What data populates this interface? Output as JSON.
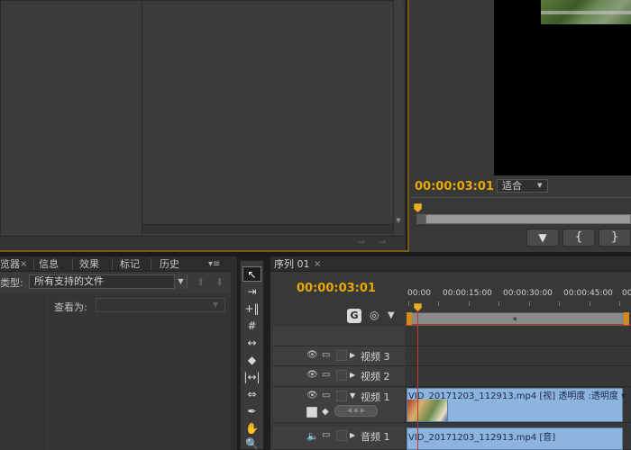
{
  "program_monitor": {
    "timecode": "00:00:03:01",
    "fit_select": "适合",
    "buttons": {
      "marker": "▼",
      "mark_in": "{",
      "mark_out": "}"
    }
  },
  "media_browser": {
    "tabs": [
      {
        "label": "览器"
      },
      {
        "label": "信息"
      },
      {
        "label": "效果"
      },
      {
        "label": "标记"
      },
      {
        "label": "历史"
      }
    ],
    "tab_close": "×",
    "menu_glyph": "▾≡",
    "type_label": "类型:",
    "type_value": "所有支持的文件",
    "view_as_label": "查看为:"
  },
  "tools": {
    "items": [
      {
        "name": "selection-tool-icon",
        "glyph": "↖"
      },
      {
        "name": "track-select-tool-icon",
        "glyph": "⇥"
      },
      {
        "name": "ripple-edit-tool-icon",
        "glyph": "+‖"
      },
      {
        "name": "rolling-edit-tool-icon",
        "glyph": "#"
      },
      {
        "name": "rate-stretch-tool-icon",
        "glyph": "↔"
      },
      {
        "name": "razor-tool-icon",
        "glyph": "◆"
      },
      {
        "name": "slip-tool-icon",
        "glyph": "|↔|"
      },
      {
        "name": "slide-tool-icon",
        "glyph": "⇔"
      },
      {
        "name": "pen-tool-icon",
        "glyph": "✒"
      },
      {
        "name": "hand-tool-icon",
        "glyph": "✋"
      },
      {
        "name": "zoom-tool-icon",
        "glyph": "🔍"
      }
    ]
  },
  "timeline": {
    "sequence_tab": "序列 01",
    "tab_close": "×",
    "timecode": "00:00:03:01",
    "ruler_labels": [
      "00:00",
      "00:00:15:00",
      "00:00:30:00",
      "00:00:45:00",
      "00"
    ],
    "tracks": {
      "video3": "视频 3",
      "video2": "视频 2",
      "video1": "视频 1",
      "audio1": "音频 1"
    },
    "clips": {
      "video": "VID_20171203_112913.mp4  [视]  透明度 :透明度 ▾",
      "audio": "VID_20171203_112913.mp4  [音]"
    }
  }
}
